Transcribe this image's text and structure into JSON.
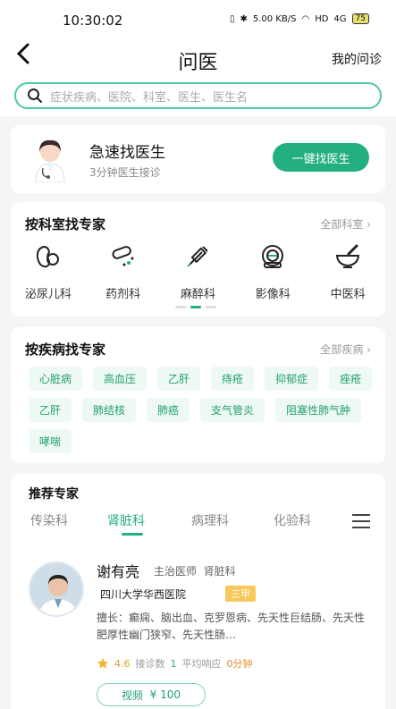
{
  "status": {
    "time": "10:30:02",
    "net": "5.00 KB/S",
    "hd": "HD",
    "signal": "4G",
    "battery": "75"
  },
  "nav": {
    "title": "问医",
    "right": "我的问诊"
  },
  "search": {
    "placeholder": "症状疾病、医院、科室、医生、医生名"
  },
  "urgent": {
    "title": "急速找医生",
    "subtitle": "3分钟医生接诊",
    "button": "一键找医生"
  },
  "dept_section": {
    "title": "按科室找专家",
    "more": "全部科室",
    "items": [
      {
        "label": "泌尿儿科",
        "icon": "kidney-icon"
      },
      {
        "label": "药剂科",
        "icon": "pills-icon"
      },
      {
        "label": "麻醉科",
        "icon": "syringe-icon"
      },
      {
        "label": "影像科",
        "icon": "scanner-icon"
      },
      {
        "label": "中医科",
        "icon": "mortar-icon"
      }
    ]
  },
  "disease_section": {
    "title": "按疾病找专家",
    "more": "全部疾病",
    "tags": [
      "心脏病",
      "高血压",
      "乙肝",
      "痔疮",
      "抑郁症",
      "痤疮",
      "乙肝",
      "肺结核",
      "肺癌",
      "支气管炎",
      "阻塞性肺气肿",
      "哮喘"
    ]
  },
  "recommend": {
    "title": "推荐专家",
    "tabs": [
      "传染科",
      "肾脏科",
      "病理科",
      "化验科"
    ],
    "active_tab": "肾脏科",
    "doctor": {
      "name": "谢有亮",
      "title": "主治医师",
      "dept": "肾脏科",
      "hospital": "四川大学华西医院",
      "level": "三甲",
      "skill": "擅长：癫痫、脑出血、克罗恩病、先天性巨结肠、先天性肥厚性幽门狭窄、先天性肠…",
      "rating": "4.6",
      "consult_label": "接诊数",
      "consult_count": "1",
      "response_label": "平均响应",
      "response_value": "0分钟",
      "video_label": "视频",
      "video_price": "¥ 100"
    }
  }
}
